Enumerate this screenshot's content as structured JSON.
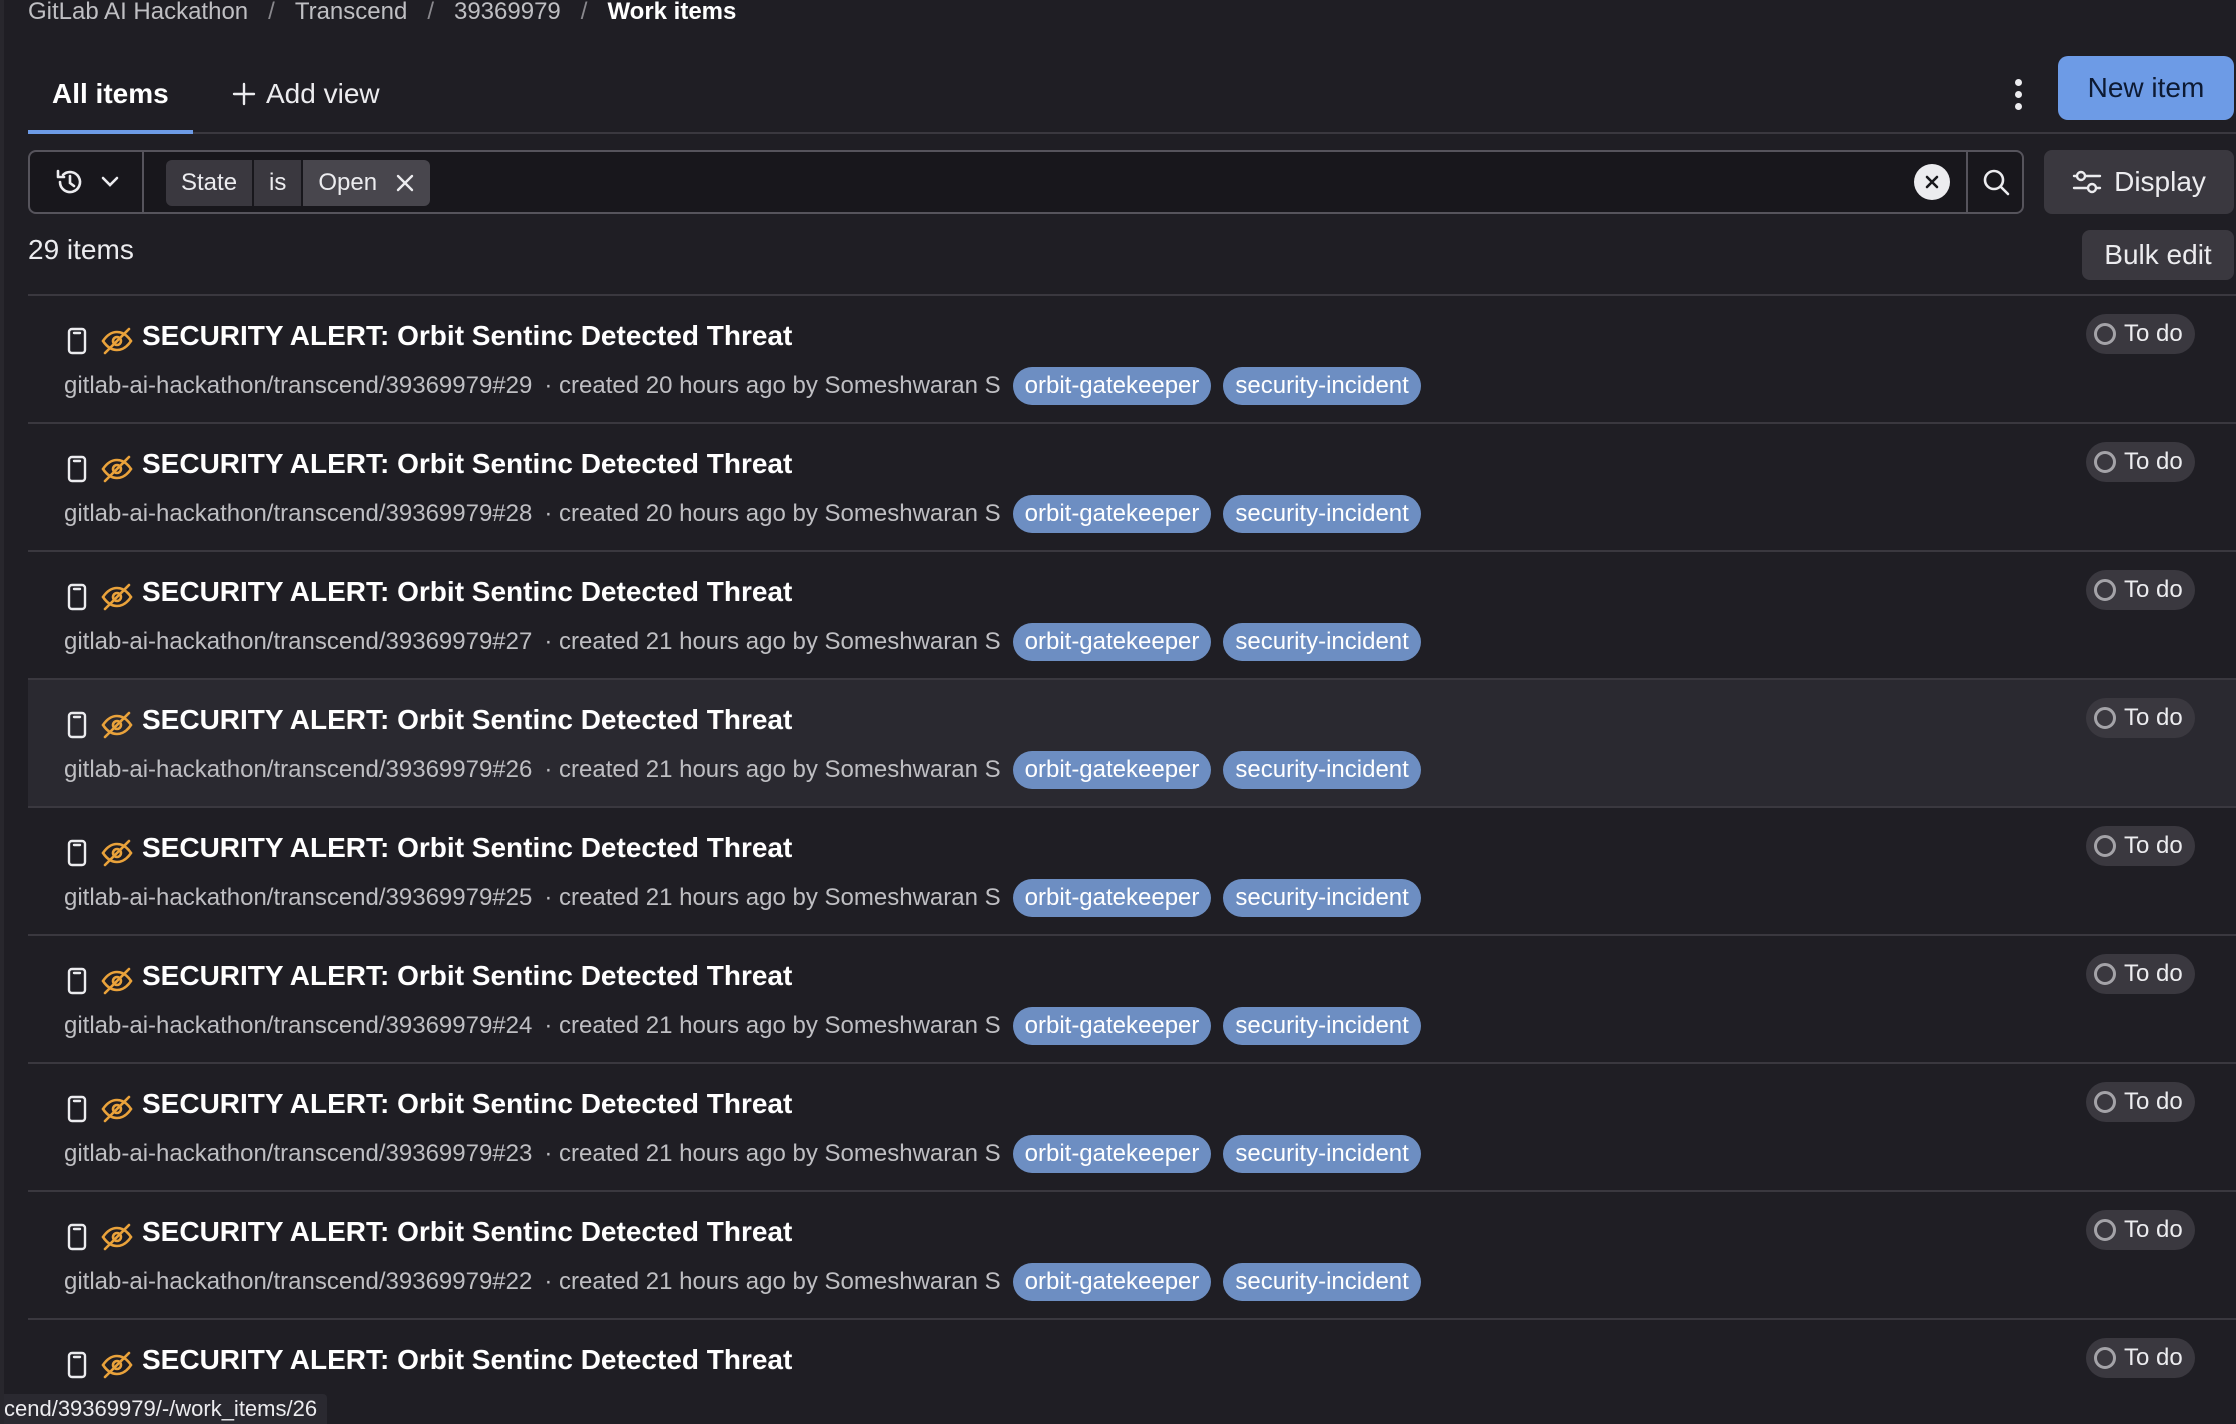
{
  "breadcrumb": [
    "GitLab AI Hackathon",
    "Transcend",
    "39369979",
    "Work items"
  ],
  "tabs": {
    "active": "All items",
    "add_view": "Add view"
  },
  "header": {
    "new_item": "New item",
    "display": "Display",
    "bulk_edit": "Bulk edit"
  },
  "filter": {
    "field": "State",
    "operator": "is",
    "value": "Open"
  },
  "count_text": "29 items",
  "items": [
    {
      "title": "SECURITY ALERT: Orbit Sentinc Detected Threat",
      "ref": "gitlab-ai-hackathon/transcend/39369979#29",
      "created": "· created 20 hours ago by Someshwaran S",
      "labels": [
        "orbit-gatekeeper",
        "security-incident"
      ],
      "status": "To do"
    },
    {
      "title": "SECURITY ALERT: Orbit Sentinc Detected Threat",
      "ref": "gitlab-ai-hackathon/transcend/39369979#28",
      "created": "· created 20 hours ago by Someshwaran S",
      "labels": [
        "orbit-gatekeeper",
        "security-incident"
      ],
      "status": "To do"
    },
    {
      "title": "SECURITY ALERT: Orbit Sentinc Detected Threat",
      "ref": "gitlab-ai-hackathon/transcend/39369979#27",
      "created": "· created 21 hours ago by Someshwaran S",
      "labels": [
        "orbit-gatekeeper",
        "security-incident"
      ],
      "status": "To do"
    },
    {
      "title": "SECURITY ALERT: Orbit Sentinc Detected Threat",
      "ref": "gitlab-ai-hackathon/transcend/39369979#26",
      "created": "· created 21 hours ago by Someshwaran S",
      "labels": [
        "orbit-gatekeeper",
        "security-incident"
      ],
      "status": "To do"
    },
    {
      "title": "SECURITY ALERT: Orbit Sentinc Detected Threat",
      "ref": "gitlab-ai-hackathon/transcend/39369979#25",
      "created": "· created 21 hours ago by Someshwaran S",
      "labels": [
        "orbit-gatekeeper",
        "security-incident"
      ],
      "status": "To do"
    },
    {
      "title": "SECURITY ALERT: Orbit Sentinc Detected Threat",
      "ref": "gitlab-ai-hackathon/transcend/39369979#24",
      "created": "· created 21 hours ago by Someshwaran S",
      "labels": [
        "orbit-gatekeeper",
        "security-incident"
      ],
      "status": "To do"
    },
    {
      "title": "SECURITY ALERT: Orbit Sentinc Detected Threat",
      "ref": "gitlab-ai-hackathon/transcend/39369979#23",
      "created": "· created 21 hours ago by Someshwaran S",
      "labels": [
        "orbit-gatekeeper",
        "security-incident"
      ],
      "status": "To do"
    },
    {
      "title": "SECURITY ALERT: Orbit Sentinc Detected Threat",
      "ref": "gitlab-ai-hackathon/transcend/39369979#22",
      "created": "· created 21 hours ago by Someshwaran S",
      "labels": [
        "orbit-gatekeeper",
        "security-incident"
      ],
      "status": "To do"
    },
    {
      "title": "SECURITY ALERT: Orbit Sentinc Detected Threat",
      "ref": "",
      "created": "",
      "labels": [],
      "status": "To do"
    }
  ],
  "hover_index": 3,
  "status_url": "cend/39369979/-/work_items/26",
  "icons": {
    "type": "issue-icon",
    "confidential": "eye-slash-icon",
    "history": "history-icon",
    "search": "search-icon",
    "display": "sliders-icon",
    "clear": "clear-icon"
  },
  "colors": {
    "accent": "#6d9be6",
    "label_bg": "#6d8ec2",
    "confidential": "#e9a23b",
    "background": "#1f1e24"
  }
}
